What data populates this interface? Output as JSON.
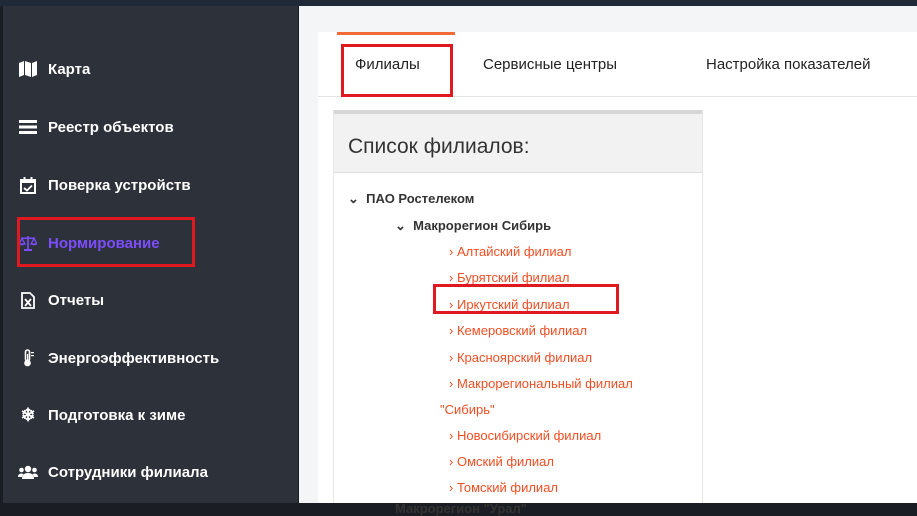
{
  "sidebar": {
    "items": [
      {
        "label": "Карта",
        "icon": "map-icon"
      },
      {
        "label": "Реестр объектов",
        "icon": "list-icon"
      },
      {
        "label": "Поверка устройств",
        "icon": "calendar-check-icon"
      },
      {
        "label": "Нормирование",
        "icon": "balance-scale-icon",
        "active": true
      },
      {
        "label": "Отчеты",
        "icon": "excel-file-icon"
      },
      {
        "label": "Энергоэффективность",
        "icon": "thermometer-icon"
      },
      {
        "label": "Подготовка к зиме",
        "icon": "snowflake-icon"
      },
      {
        "label": "Сотрудники филиала",
        "icon": "users-icon"
      }
    ]
  },
  "tabs": [
    {
      "label": "Филиалы",
      "active": true
    },
    {
      "label": "Сервисные центры"
    },
    {
      "label": "Настройка показателей"
    }
  ],
  "panel": {
    "title": "Список филиалов:",
    "tree": {
      "root": "ПАО Ростелеком",
      "region": "Макрорегион Сибирь",
      "branches": [
        "Алтайский филиал",
        "Бурятский филиал",
        "Иркутский филиал",
        "Кемеровский филиал",
        "Красноярский филиал",
        "Макрорегиональный филиал",
        "\"Сибирь\"",
        "Новосибирский филиал",
        "Омский филиал",
        "Томский филиал"
      ],
      "next_region": "Макрорегион \"Урал\""
    }
  },
  "colors": {
    "sidebar_bg": "#2d3139",
    "active_accent": "#7c4dff",
    "link": "#f04e23",
    "highlight": "#e0181f",
    "tab_accent": "#f26a36"
  }
}
